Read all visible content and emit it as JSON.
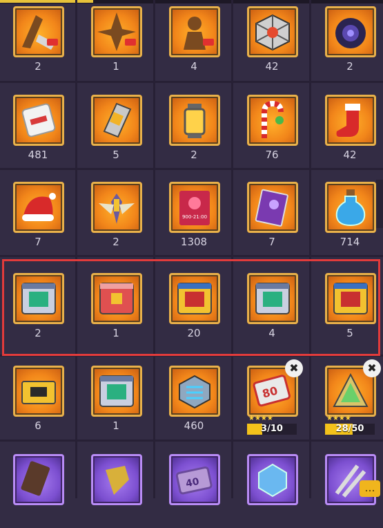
{
  "title": "",
  "rows": [
    [
      {
        "icon": "skill-scroll-icon",
        "count": "2"
      },
      {
        "icon": "skill-scroll-icon",
        "count": "1"
      },
      {
        "icon": "skill-scroll-icon",
        "count": "4"
      },
      {
        "icon": "cube-icon",
        "count": "42"
      },
      {
        "icon": "dark-core-icon",
        "count": "2"
      }
    ],
    [
      {
        "icon": "ticket-card-icon",
        "count": "481"
      },
      {
        "icon": "data-chip-icon",
        "count": "5"
      },
      {
        "icon": "lantern-icon",
        "count": "2"
      },
      {
        "icon": "candy-cane-icon",
        "count": "76"
      },
      {
        "icon": "christmas-stocking-icon",
        "count": "42"
      }
    ],
    [
      {
        "icon": "santa-hat-icon",
        "count": "7"
      },
      {
        "icon": "winged-emblem-icon",
        "count": "2"
      },
      {
        "icon": "red-ticket-icon",
        "count": "1308",
        "ticket_text": "900-21:00"
      },
      {
        "icon": "purple-manual-icon",
        "count": "7"
      },
      {
        "icon": "potion-bottle-icon",
        "count": "714"
      }
    ],
    [
      {
        "icon": "silver-supply-box-icon",
        "count": "2"
      },
      {
        "icon": "red-supply-box-icon",
        "count": "1"
      },
      {
        "icon": "gold-supply-box-icon",
        "count": "20"
      },
      {
        "icon": "silver-supply-box-icon",
        "count": "4"
      },
      {
        "icon": "gold-supply-box-icon",
        "count": "5"
      }
    ],
    [
      {
        "icon": "gold-chest-icon",
        "count": "6"
      },
      {
        "icon": "silver-supply-box-icon",
        "count": "1"
      },
      {
        "icon": "tech-module-icon",
        "count": "460"
      },
      {
        "icon": "coupon-80-icon",
        "count": "",
        "progress": "3/10",
        "progress_value": 0.3,
        "stars": "★★★★",
        "badge": "✖"
      },
      {
        "icon": "triangle-shard-icon",
        "count": "",
        "progress": "28/50",
        "progress_value": 0.56,
        "stars": "★★★★",
        "badge": "✖"
      }
    ],
    [
      {
        "icon": "purple-device-icon",
        "count": ""
      },
      {
        "icon": "golden-rune-icon",
        "count": ""
      },
      {
        "icon": "coupon-40-icon",
        "count": "",
        "ticket_text": "40"
      },
      {
        "icon": "crystal-cube-icon",
        "count": ""
      },
      {
        "icon": "scissors-blade-icon",
        "count": ""
      }
    ]
  ],
  "row4_labels": {
    "coupon80": "80",
    "tri_text": ""
  },
  "chat_button_label": "…"
}
